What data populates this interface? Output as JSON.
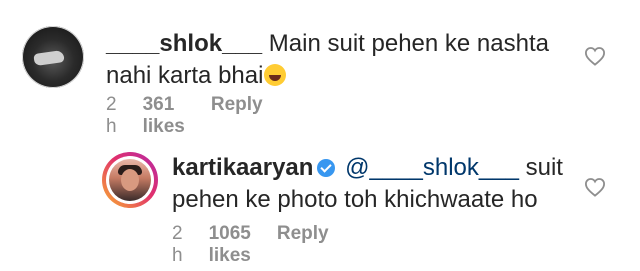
{
  "comments": [
    {
      "username": "____shlok___",
      "text": "Main suit pehen ke nashta nahi karta bhai",
      "emoji": "face-with-tears-of-joy",
      "time": "2 h",
      "likes": "361 likes",
      "reply_label": "Reply"
    },
    {
      "username": "kartikaaryan",
      "verified": true,
      "mention": "@____shlok___",
      "text": " suit pehen ke photo toh khichwaate ho",
      "time": "2 h",
      "likes": "1065 likes",
      "reply_label": "Reply"
    }
  ],
  "colors": {
    "text": "#262626",
    "meta": "#8e8e8e",
    "mention": "#00376b",
    "verified": "#3897f0"
  },
  "icons": [
    "heart-outline-icon",
    "verified-badge-icon",
    "face-with-tears-of-joy-emoji"
  ]
}
